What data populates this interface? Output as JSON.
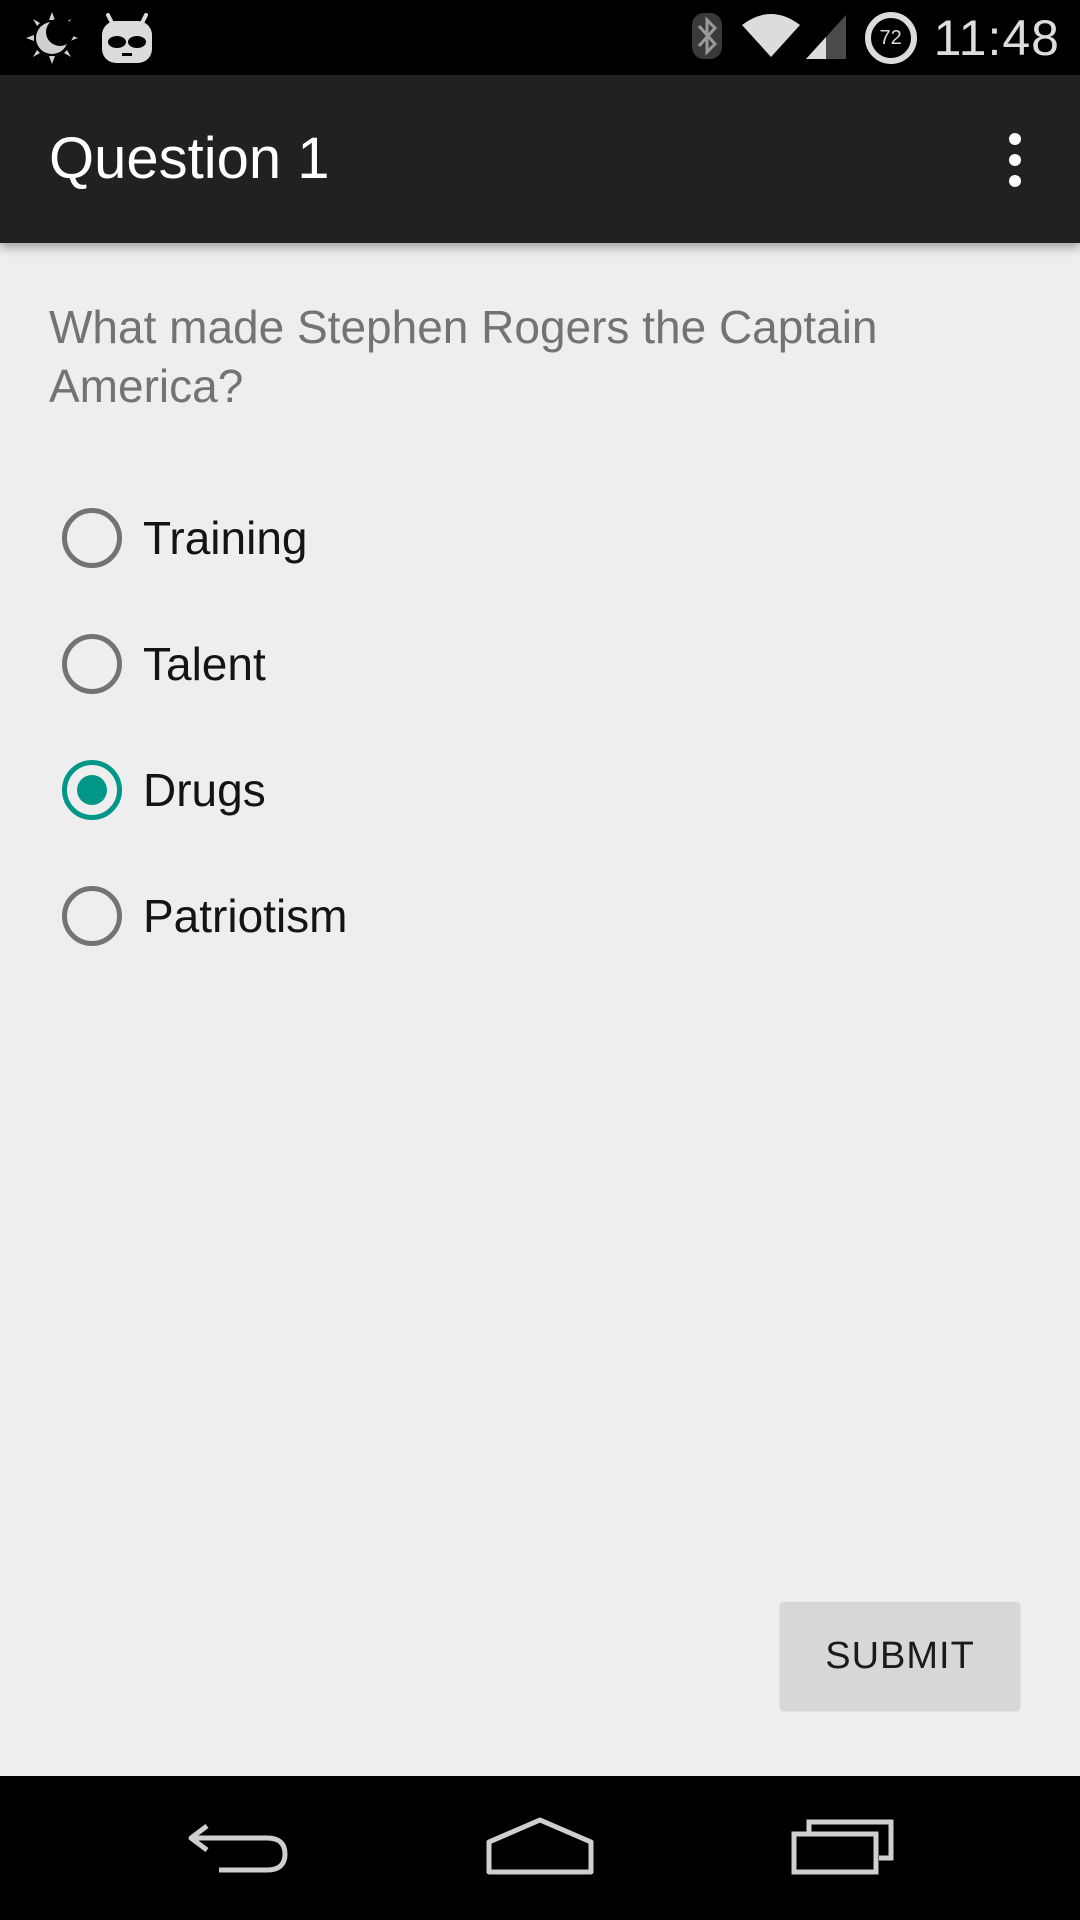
{
  "status_bar": {
    "time": "11:48",
    "battery_level": "72",
    "icons": [
      "weather-moon-icon",
      "cyanogen-android-icon",
      "bluetooth-icon",
      "wifi-icon",
      "cell-signal-icon",
      "battery-icon"
    ]
  },
  "app_bar": {
    "title": "Question 1",
    "overflow_icon": "more-vert-icon"
  },
  "question": {
    "text": "What made Stephen Rogers the Captain America?"
  },
  "options": [
    {
      "label": "Training",
      "checked": false
    },
    {
      "label": "Talent",
      "checked": false
    },
    {
      "label": "Drugs",
      "checked": true
    },
    {
      "label": "Patriotism",
      "checked": false
    }
  ],
  "submit": {
    "label": "SUBMIT"
  },
  "nav_bar": {
    "icons": [
      "back-icon",
      "home-icon",
      "recents-icon"
    ]
  },
  "colors": {
    "accent": "#009688",
    "app_bar": "#212121",
    "background": "#eeeeee",
    "button": "#d6d7d7"
  }
}
